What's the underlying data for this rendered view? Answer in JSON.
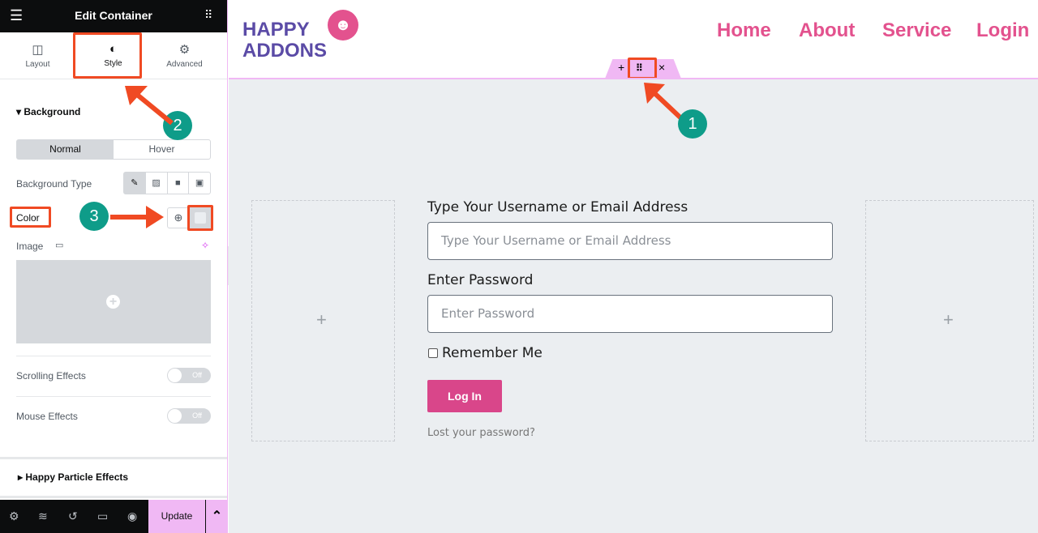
{
  "panel": {
    "title": "Edit Container",
    "tabs": [
      {
        "label": "Layout",
        "icon": "columns-icon"
      },
      {
        "label": "Style",
        "icon": "half-circle-icon"
      },
      {
        "label": "Advanced",
        "icon": "gear-icon"
      }
    ],
    "active_tab": "Style",
    "background_section": "Background",
    "state_tabs": [
      "Normal",
      "Hover"
    ],
    "background_type_label": "Background Type",
    "color_label": "Color",
    "image_label": "Image",
    "scrolling_effects_label": "Scrolling Effects",
    "scrolling_effects_value": "Off",
    "mouse_effects_label": "Mouse Effects",
    "mouse_effects_value": "Off",
    "particle_section": "Happy Particle Effects",
    "update_label": "Update"
  },
  "annotations": {
    "step1": "1",
    "step2": "2",
    "step3": "3"
  },
  "header": {
    "logo_line1": "HAPPY",
    "logo_line2": "ADDONS",
    "nav": [
      "Home",
      "About",
      "Service",
      "Login"
    ]
  },
  "form": {
    "username_label": "Type Your Username or Email Address",
    "username_placeholder": "Type Your Username or Email Address",
    "password_label": "Enter Password",
    "password_placeholder": "Enter Password",
    "remember_label": "Remember Me",
    "remember_checked": false,
    "login_button": "Log In",
    "lost_password": "Lost your password?"
  },
  "colors": {
    "accent": "#e3528e",
    "brand_purple": "#5b4ba6",
    "annotation_red": "#f04a23",
    "annotation_teal": "#0e9c89",
    "editor_pink": "#f0b8f4"
  }
}
